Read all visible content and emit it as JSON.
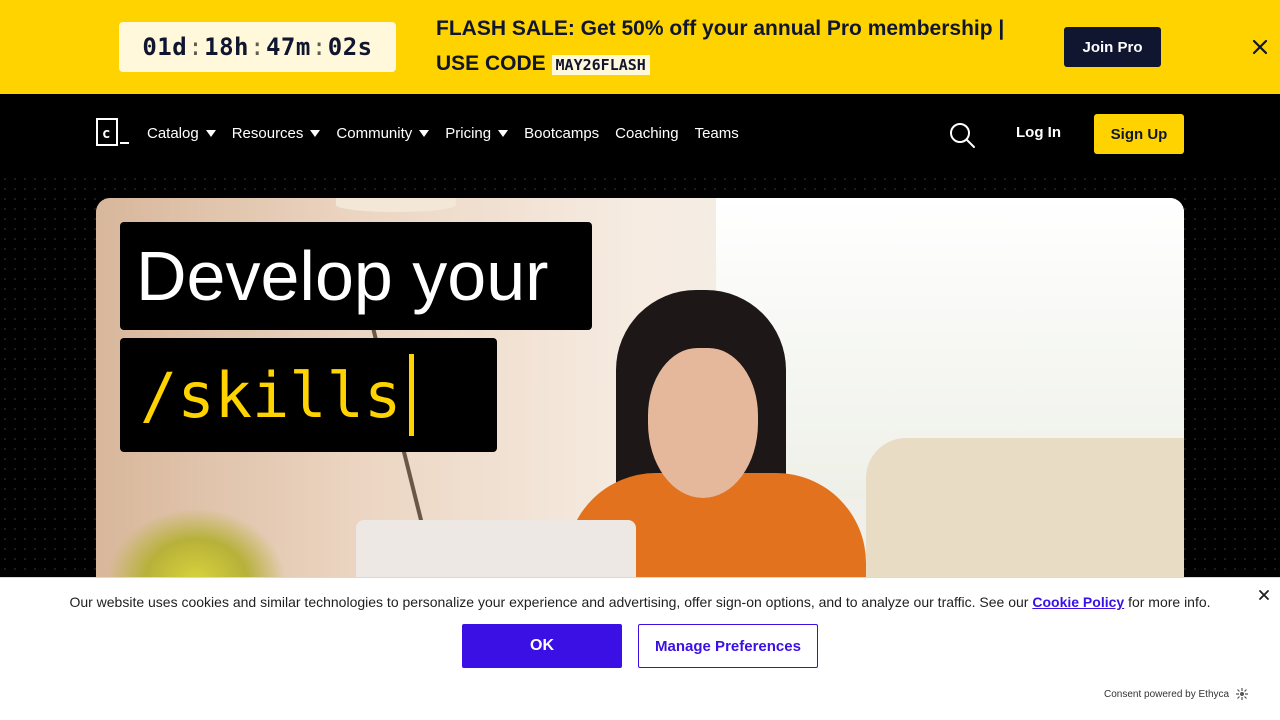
{
  "promo": {
    "countdown": {
      "days": "01d",
      "hours": "18h",
      "minutes": "47m",
      "seconds": "02s",
      "separator": ":"
    },
    "text": "FLASH SALE: Get 50% off your annual Pro membership | USE CODE",
    "code": "MAY26FLASH",
    "cta": "Join Pro",
    "colors": {
      "background": "#ffd300",
      "cta_bg": "#10162f"
    }
  },
  "nav": {
    "logo_icon": "codecademy-logo-icon",
    "items": [
      {
        "label": "Catalog",
        "dropdown": true
      },
      {
        "label": "Resources",
        "dropdown": true
      },
      {
        "label": "Community",
        "dropdown": true
      },
      {
        "label": "Pricing",
        "dropdown": true
      },
      {
        "label": "Bootcamps",
        "dropdown": false
      },
      {
        "label": "Coaching",
        "dropdown": false
      },
      {
        "label": "Teams",
        "dropdown": false
      }
    ],
    "search_icon": "search-icon",
    "login": "Log In",
    "signup": "Sign Up"
  },
  "hero": {
    "headline": "Develop your",
    "subline": "/skills",
    "accent": "#ffd300"
  },
  "cookie": {
    "text_before": "Our website uses cookies and similar technologies to personalize your experience and advertising, offer sign-on options, and to analyze our traffic. See our",
    "link": "Cookie Policy",
    "text_after": "for more info.",
    "ok": "OK",
    "manage": "Manage Preferences",
    "powered_by": "Consent powered by Ethyca",
    "accent": "#3a10e5"
  }
}
